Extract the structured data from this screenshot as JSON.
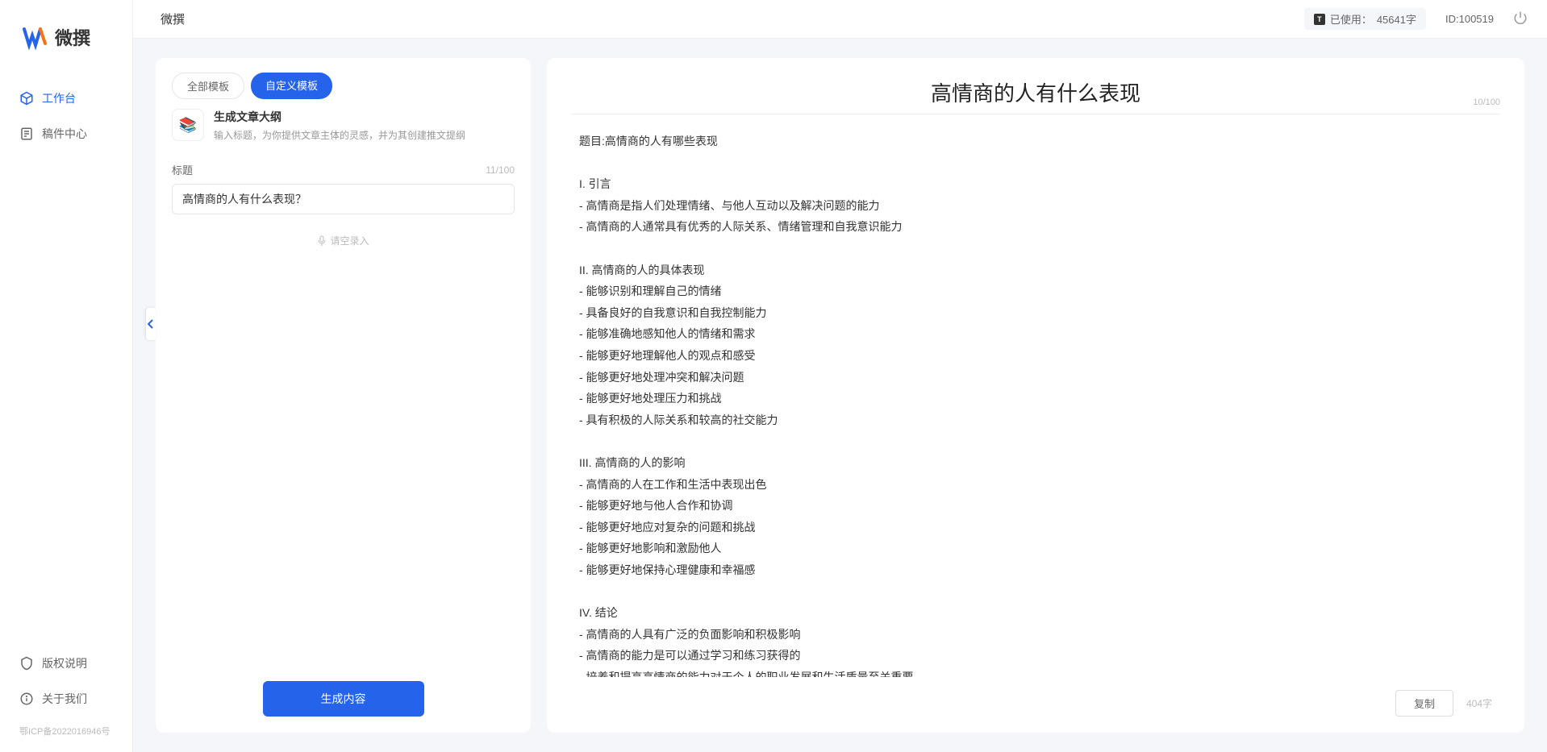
{
  "brand": {
    "name": "微撰"
  },
  "sidebar": {
    "nav": [
      {
        "label": "工作台",
        "active": true
      },
      {
        "label": "稿件中心",
        "active": false
      }
    ],
    "bottom": [
      {
        "label": "版权说明"
      },
      {
        "label": "关于我们"
      }
    ],
    "footer": "鄂ICP备2022016946号"
  },
  "header": {
    "title": "微撰",
    "usage_prefix": "已使用：",
    "usage_value": "45641字",
    "user_id_label": "ID:",
    "user_id": "100519"
  },
  "leftPanel": {
    "tabs": [
      {
        "label": "全部模板",
        "active": false
      },
      {
        "label": "自定义模板",
        "active": true
      }
    ],
    "template": {
      "icon": "📚",
      "title": "生成文章大纲",
      "desc": "输入标题，为你提供文章主体的灵感，并为其创建推文提纲"
    },
    "form": {
      "label": "标题",
      "counter": "11/100",
      "value": "高情商的人有什么表现？"
    },
    "voice_hint": "请空录入",
    "generate_btn": "生成内容"
  },
  "rightPanel": {
    "title": "高情商的人有什么表现",
    "title_counter": "10/100",
    "body": "题目:高情商的人有哪些表现\n\nI. 引言\n- 高情商是指人们处理情绪、与他人互动以及解决问题的能力\n- 高情商的人通常具有优秀的人际关系、情绪管理和自我意识能力\n\nII. 高情商的人的具体表现\n- 能够识别和理解自己的情绪\n- 具备良好的自我意识和自我控制能力\n- 能够准确地感知他人的情绪和需求\n- 能够更好地理解他人的观点和感受\n- 能够更好地处理冲突和解决问题\n- 能够更好地处理压力和挑战\n- 具有积极的人际关系和较高的社交能力\n\nIII. 高情商的人的影响\n- 高情商的人在工作和生活中表现出色\n- 能够更好地与他人合作和协调\n- 能够更好地应对复杂的问题和挑战\n- 能够更好地影响和激励他人\n- 能够更好地保持心理健康和幸福感\n\nIV. 结论\n- 高情商的人具有广泛的负面影响和积极影响\n- 高情商的能力是可以通过学习和练习获得的\n- 培养和提高高情商的能力对于个人的职业发展和生活质量至关重要。",
    "copy_btn": "复制",
    "word_count": "404字"
  }
}
